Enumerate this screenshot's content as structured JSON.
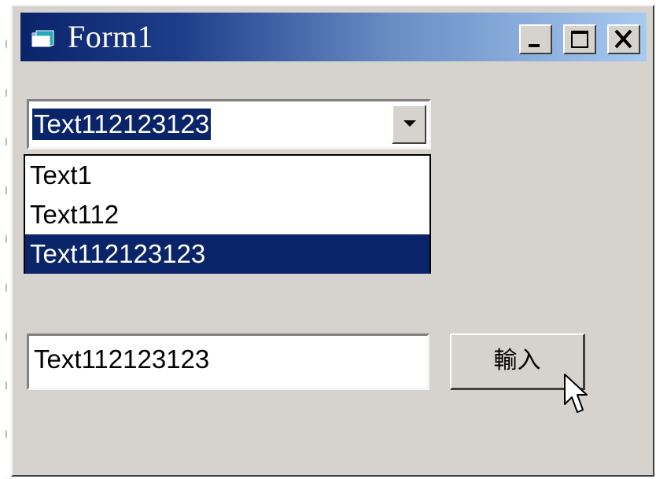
{
  "window": {
    "title": "Form1",
    "icon": "form-window-icon",
    "caption_buttons": {
      "minimize": "minimize-icon",
      "maximize": "maximize-icon",
      "close": "close-icon"
    }
  },
  "combo": {
    "value": "Text112123123",
    "arrow_icon": "chevron-down-icon"
  },
  "dropdown": {
    "items": [
      "Text1",
      "Text112",
      "Text112123123"
    ],
    "selected_index": 2
  },
  "textbox": {
    "value": "Text112123123"
  },
  "button": {
    "label": "輸入"
  },
  "colors": {
    "selection": "#0a246a",
    "face": "#d6d3ce",
    "title_gradient_start": "#0a246a",
    "title_gradient_end": "#a6caf0"
  }
}
